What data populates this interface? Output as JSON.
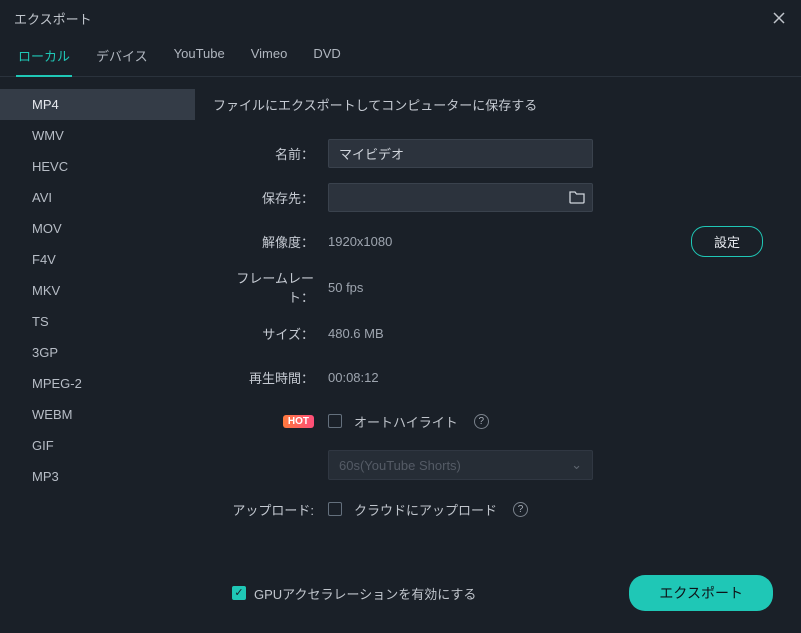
{
  "window_title": "エクスポート",
  "tabs": [
    "ローカル",
    "デバイス",
    "YouTube",
    "Vimeo",
    "DVD"
  ],
  "active_tab_index": 0,
  "formats": [
    "MP4",
    "WMV",
    "HEVC",
    "AVI",
    "MOV",
    "F4V",
    "MKV",
    "TS",
    "3GP",
    "MPEG-2",
    "WEBM",
    "GIF",
    "MP3"
  ],
  "selected_format_index": 0,
  "section_title": "ファイルにエクスポートしてコンピューターに保存する",
  "labels": {
    "name": "名前：",
    "save_to": "保存先：",
    "resolution": "解像度：",
    "framerate": "フレームレート：",
    "size": "サイズ：",
    "duration": "再生時間：",
    "upload": "アップロード:"
  },
  "values": {
    "name": "マイビデオ",
    "save_path": "",
    "resolution": "1920x1080",
    "framerate": "50 fps",
    "size": "480.6 MB",
    "duration": "00:08:12"
  },
  "settings_button": "設定",
  "hot_badge": "HOT",
  "auto_highlight_label": "オートハイライト",
  "auto_highlight_checked": false,
  "shorts_dropdown": "60s(YouTube Shorts)",
  "cloud_upload_label": "クラウドにアップロード",
  "cloud_upload_checked": false,
  "gpu_accel_label": "GPUアクセラレーションを有効にする",
  "gpu_accel_checked": true,
  "export_button": "エクスポート"
}
